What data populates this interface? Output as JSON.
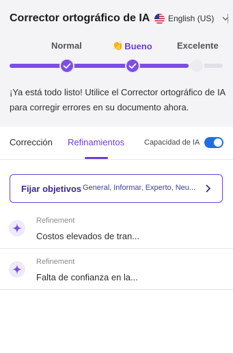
{
  "app": {
    "title": "Corrector ortográfico de IA",
    "language": "English (US)",
    "language_flag_icon": "us-flag-icon"
  },
  "levels": {
    "items": [
      {
        "label": "Normal",
        "completed": true
      },
      {
        "label": "Bueno",
        "completed": true,
        "emoji": "👏"
      },
      {
        "label": "Excelente",
        "completed": false
      }
    ],
    "progress": 0.84,
    "accent_color": "#7c4ee4"
  },
  "message": "¡Ya está todo listo! Utilice el Corrector ortográfico de IA para corregir errores en su documento ahora.",
  "tabs": {
    "items": [
      {
        "label": "Corrección",
        "active": false
      },
      {
        "label": "Refinamientos",
        "active": true
      }
    ],
    "ai_capability": {
      "label": "Capacidad de IA",
      "enabled": true,
      "color": "#1f6fe0"
    }
  },
  "goals": {
    "label": "Fijar objetivos",
    "values": "General, Informar, Experto, Neu..."
  },
  "refinements": [
    {
      "kind": "Refinement",
      "text": "Costos elevados de tran..."
    },
    {
      "kind": "Refinement",
      "text": "Falta de confianza en la..."
    }
  ]
}
